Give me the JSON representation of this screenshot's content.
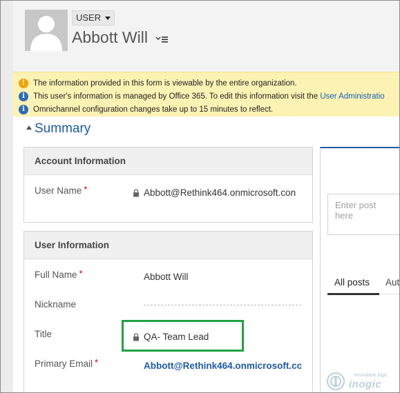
{
  "header": {
    "entity_label": "USER",
    "record_name": "Abbott Will"
  },
  "notifications": [
    {
      "type": "warning",
      "text": "The information provided in this form is viewable by the entire organization."
    },
    {
      "type": "info",
      "text": "This user's information is managed by Office 365. To edit this information visit the ",
      "link": "User Administratio"
    },
    {
      "type": "info",
      "text": "Omnichannel configuration changes take up to 15 minutes to reflect."
    }
  ],
  "summary": {
    "title": "Summary"
  },
  "account_section": {
    "title": "Account Information",
    "user_name_label": "User Name",
    "user_name_required": "*",
    "user_name_value": "Abbott@Rethink464.onmicrosoft.con"
  },
  "user_section": {
    "title": "User Information",
    "full_name_label": "Full Name",
    "full_name_required": "*",
    "full_name_value": "Abbott Will",
    "nickname_label": "Nickname",
    "title_label": "Title",
    "title_value": "QA- Team Lead",
    "email_label": "Primary Email",
    "email_required": "*",
    "email_value": "Abbott@Rethink464.onmicrosoft.co"
  },
  "timeline": {
    "post_placeholder": "Enter post here",
    "tab_all_posts": "All posts",
    "tab_auto": "Aut"
  },
  "watermark": {
    "tagline": "innovative logic",
    "brand": "inogic"
  },
  "colors": {
    "accent": "#1e5aa6",
    "warning": "#f0a30a",
    "info": "#2f6cbf",
    "highlight": "#21a142",
    "notification_bg": "#fcf2b3"
  }
}
